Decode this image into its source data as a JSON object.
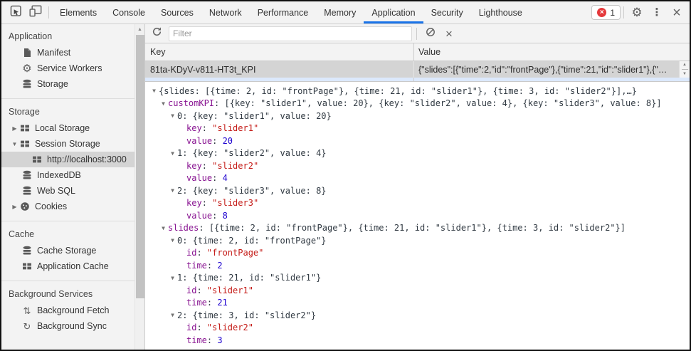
{
  "colors": {
    "accent": "#1a73e8",
    "property": "#881391",
    "string": "#c41a16",
    "number": "#1c00cf",
    "error": "#e5393c",
    "selection_gray": "#d4d4d4",
    "icon_gray": "#5a5a5a"
  },
  "toolbar": {
    "tabs": [
      {
        "label": "Elements"
      },
      {
        "label": "Console"
      },
      {
        "label": "Sources"
      },
      {
        "label": "Network"
      },
      {
        "label": "Performance"
      },
      {
        "label": "Memory"
      },
      {
        "label": "Application",
        "selected": true
      },
      {
        "label": "Security"
      },
      {
        "label": "Lighthouse"
      }
    ],
    "error_badge": "1"
  },
  "sidebar": {
    "sections": [
      {
        "title": "Application",
        "items": [
          {
            "label": "Manifest",
            "icon": "document-icon"
          },
          {
            "label": "Service Workers",
            "icon": "gear-icon"
          },
          {
            "label": "Storage",
            "icon": "database-icon"
          }
        ]
      },
      {
        "title": "Storage",
        "items": [
          {
            "label": "Local Storage",
            "icon": "table-icon",
            "arrow": "collapsed"
          },
          {
            "label": "Session Storage",
            "icon": "table-icon",
            "arrow": "expanded"
          },
          {
            "label": "http://localhost:3000",
            "icon": "table-icon",
            "indent": 1,
            "selected": true
          },
          {
            "label": "IndexedDB",
            "icon": "database-icon"
          },
          {
            "label": "Web SQL",
            "icon": "database-icon"
          },
          {
            "label": "Cookies",
            "icon": "cookie-icon",
            "arrow": "collapsed"
          }
        ]
      },
      {
        "title": "Cache",
        "items": [
          {
            "label": "Cache Storage",
            "icon": "database-icon"
          },
          {
            "label": "Application Cache",
            "icon": "table-icon"
          }
        ]
      },
      {
        "title": "Background Services",
        "items": [
          {
            "label": "Background Fetch",
            "icon": "fetch-icon"
          },
          {
            "label": "Background Sync",
            "icon": "sync-icon"
          }
        ]
      }
    ]
  },
  "main": {
    "filter_placeholder": "Filter",
    "columns": [
      "Key",
      "Value"
    ],
    "row": {
      "key": "81ta-KDyV-v811-HT3t_KPI",
      "value": "{\"slides\":[{\"time\":2,\"id\":\"frontPage\"},{\"time\":21,\"id\":\"slider1\"},{\"…"
    },
    "tree": [
      {
        "i": 0,
        "a": true,
        "tok": [
          [
            "{slides: [{time: 2, id: \"frontPage\"}, {time: 21, id: \"slider1\"}, {time: 3, id: \"slider2\"}],…}",
            "p"
          ]
        ]
      },
      {
        "i": 1,
        "a": true,
        "tok": [
          [
            "customKPI",
            "n"
          ],
          [
            ": ",
            "p"
          ],
          [
            "[{key: \"slider1\", value: 20}, {key: \"slider2\", value: 4}, {key: \"slider3\", value: 8}]",
            "p"
          ]
        ]
      },
      {
        "i": 2,
        "a": true,
        "tok": [
          [
            "0: {key: \"slider1\", value: 20}",
            "p"
          ]
        ]
      },
      {
        "i": 3,
        "a": false,
        "tok": [
          [
            "key",
            "n"
          ],
          [
            ": ",
            "p"
          ],
          [
            "\"slider1\"",
            "s"
          ]
        ]
      },
      {
        "i": 3,
        "a": false,
        "tok": [
          [
            "value",
            "n"
          ],
          [
            ": ",
            "p"
          ],
          [
            "20",
            "d"
          ]
        ]
      },
      {
        "i": 2,
        "a": true,
        "tok": [
          [
            "1: {key: \"slider2\", value: 4}",
            "p"
          ]
        ]
      },
      {
        "i": 3,
        "a": false,
        "tok": [
          [
            "key",
            "n"
          ],
          [
            ": ",
            "p"
          ],
          [
            "\"slider2\"",
            "s"
          ]
        ]
      },
      {
        "i": 3,
        "a": false,
        "tok": [
          [
            "value",
            "n"
          ],
          [
            ": ",
            "p"
          ],
          [
            "4",
            "d"
          ]
        ]
      },
      {
        "i": 2,
        "a": true,
        "tok": [
          [
            "2: {key: \"slider3\", value: 8}",
            "p"
          ]
        ]
      },
      {
        "i": 3,
        "a": false,
        "tok": [
          [
            "key",
            "n"
          ],
          [
            ": ",
            "p"
          ],
          [
            "\"slider3\"",
            "s"
          ]
        ]
      },
      {
        "i": 3,
        "a": false,
        "tok": [
          [
            "value",
            "n"
          ],
          [
            ": ",
            "p"
          ],
          [
            "8",
            "d"
          ]
        ]
      },
      {
        "i": 1,
        "a": true,
        "tok": [
          [
            "slides",
            "n"
          ],
          [
            ": ",
            "p"
          ],
          [
            "[{time: 2, id: \"frontPage\"}, {time: 21, id: \"slider1\"}, {time: 3, id: \"slider2\"}]",
            "p"
          ]
        ]
      },
      {
        "i": 2,
        "a": true,
        "tok": [
          [
            "0: {time: 2, id: \"frontPage\"}",
            "p"
          ]
        ]
      },
      {
        "i": 3,
        "a": false,
        "tok": [
          [
            "id",
            "n"
          ],
          [
            ": ",
            "p"
          ],
          [
            "\"frontPage\"",
            "s"
          ]
        ]
      },
      {
        "i": 3,
        "a": false,
        "tok": [
          [
            "time",
            "n"
          ],
          [
            ": ",
            "p"
          ],
          [
            "2",
            "d"
          ]
        ]
      },
      {
        "i": 2,
        "a": true,
        "tok": [
          [
            "1: {time: 21, id: \"slider1\"}",
            "p"
          ]
        ]
      },
      {
        "i": 3,
        "a": false,
        "tok": [
          [
            "id",
            "n"
          ],
          [
            ": ",
            "p"
          ],
          [
            "\"slider1\"",
            "s"
          ]
        ]
      },
      {
        "i": 3,
        "a": false,
        "tok": [
          [
            "time",
            "n"
          ],
          [
            ": ",
            "p"
          ],
          [
            "21",
            "d"
          ]
        ]
      },
      {
        "i": 2,
        "a": true,
        "tok": [
          [
            "2: {time: 3, id: \"slider2\"}",
            "p"
          ]
        ]
      },
      {
        "i": 3,
        "a": false,
        "tok": [
          [
            "id",
            "n"
          ],
          [
            ": ",
            "p"
          ],
          [
            "\"slider2\"",
            "s"
          ]
        ]
      },
      {
        "i": 3,
        "a": false,
        "tok": [
          [
            "time",
            "n"
          ],
          [
            ": ",
            "p"
          ],
          [
            "3",
            "d"
          ]
        ]
      }
    ]
  }
}
